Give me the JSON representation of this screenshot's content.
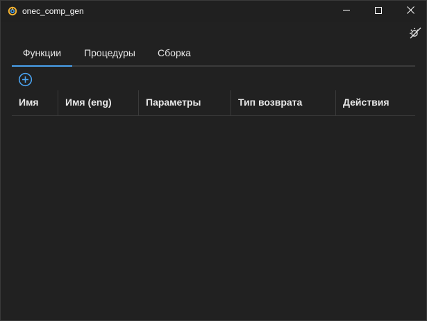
{
  "window": {
    "title": "onec_comp_gen",
    "icon": "app-logo-icon",
    "controls": {
      "minimize_icon": "minimize-icon",
      "maximize_icon": "maximize-icon",
      "close_icon": "close-icon"
    }
  },
  "toolbar": {
    "theme_toggle_icon": "theme-toggle-icon"
  },
  "tabs": [
    {
      "label": "Функции",
      "active": true
    },
    {
      "label": "Процедуры",
      "active": false
    },
    {
      "label": "Сборка",
      "active": false
    }
  ],
  "actions": {
    "add_icon": "add-circle-icon"
  },
  "table": {
    "columns": [
      {
        "label": "Имя"
      },
      {
        "label": "Имя (eng)"
      },
      {
        "label": "Параметры"
      },
      {
        "label": "Тип возврата"
      },
      {
        "label": "Действия"
      }
    ],
    "rows": []
  },
  "colors": {
    "background": "#212121",
    "text": "#e6e6e6",
    "accent": "#4aa3f0",
    "divider": "#3a3a3a"
  }
}
